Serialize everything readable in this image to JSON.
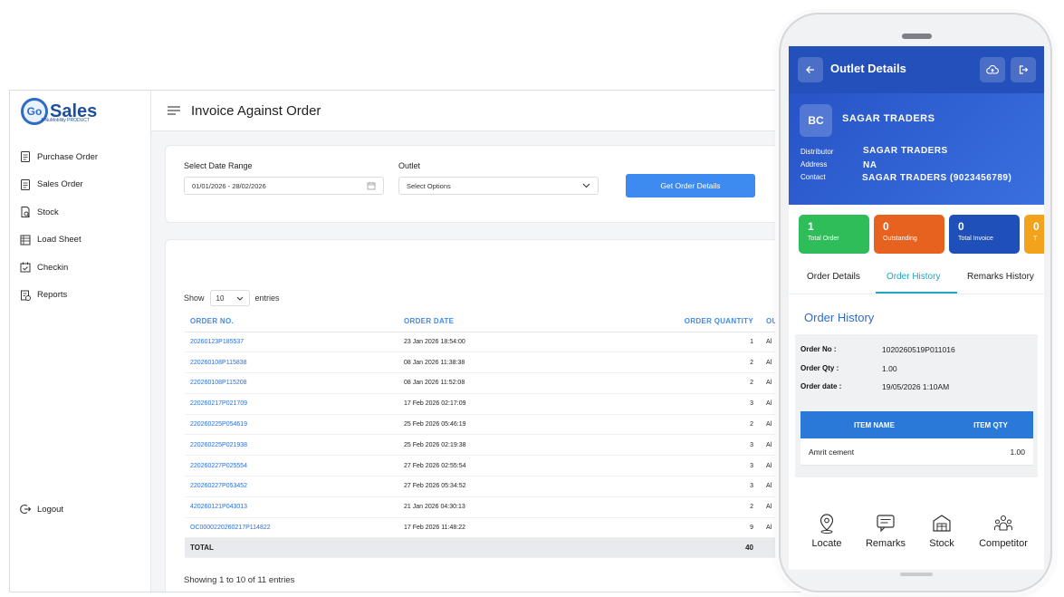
{
  "app": {
    "logo_text": "Sales",
    "logo_mark": "Go",
    "logo_sub": "A NuMobility PRODUCT",
    "page_title": "Invoice Against Order",
    "sidebar": {
      "items": [
        {
          "label": "Purchase Order",
          "icon": "document-icon"
        },
        {
          "label": "Sales Order",
          "icon": "document-icon"
        },
        {
          "label": "Stock",
          "icon": "search-document-icon"
        },
        {
          "label": "Load Sheet",
          "icon": "sheet-icon"
        },
        {
          "label": "Checkin",
          "icon": "calendar-check-icon"
        },
        {
          "label": "Reports",
          "icon": "report-icon"
        }
      ],
      "logout_label": "Logout"
    },
    "filters": {
      "date_label": "Select Date Range",
      "date_value": "01/01/2026 - 28/02/2026",
      "outlet_label": "Outlet",
      "outlet_value": "Select Options",
      "button_label": "Get Order Details"
    },
    "table": {
      "show_label": "Show",
      "entries_label": "entries",
      "page_size": "10",
      "columns": [
        "ORDER NO.",
        "ORDER DATE",
        "ORDER QUANTITY",
        "OU"
      ],
      "rows": [
        {
          "order_no": "20260123P185537",
          "date": "23 Jan 2026 18:54:00",
          "qty": "1",
          "ou": "Al"
        },
        {
          "order_no": "220260108P115838",
          "date": "08 Jan 2026 11:38:38",
          "qty": "2",
          "ou": "Al"
        },
        {
          "order_no": "220260108P115208",
          "date": "08 Jan 2026 11:52:08",
          "qty": "2",
          "ou": "Al"
        },
        {
          "order_no": "220260217P021709",
          "date": "17 Feb 2026 02:17:09",
          "qty": "3",
          "ou": "Al"
        },
        {
          "order_no": "220260225P054619",
          "date": "25 Feb 2026 05:46:19",
          "qty": "2",
          "ou": "Al"
        },
        {
          "order_no": "220260225P021938",
          "date": "25 Feb 2026 02:19:38",
          "qty": "3",
          "ou": "Al"
        },
        {
          "order_no": "220260227P025554",
          "date": "27 Feb 2026 02:55:54",
          "qty": "3",
          "ou": "Al"
        },
        {
          "order_no": "220260227P053452",
          "date": "27 Feb 2026 05:34:52",
          "qty": "3",
          "ou": "Al"
        },
        {
          "order_no": "420260121P043013",
          "date": "21 Jan 2026 04:30:13",
          "qty": "2",
          "ou": "Al"
        },
        {
          "order_no": "OC0000220260217P114822",
          "date": "17 Feb 2026 11:48:22",
          "qty": "9",
          "ou": "Al"
        }
      ],
      "total_label": "TOTAL",
      "total_qty": "40",
      "info": "Showing 1 to 10 of 11 entries"
    }
  },
  "phone": {
    "title": "Outlet Details",
    "avatar": "BC",
    "outlet_name": "SAGAR TRADERS",
    "distributor_label": "Distributor",
    "distributor_value": "SAGAR TRADERS",
    "address_label": "Address",
    "address_value": "NA",
    "contact_label": "Contact",
    "contact_value": "SAGAR TRADERS (9023456789)",
    "stats": [
      {
        "value": "1",
        "label": "Total Order",
        "color": "#2ebd59"
      },
      {
        "value": "0",
        "label": "Outstanding",
        "color": "#e8621f"
      },
      {
        "value": "0",
        "label": "Total Invoice",
        "color": "#1f4fb8"
      },
      {
        "value": "0",
        "label": "T",
        "color": "#f3a21c"
      }
    ],
    "tabs": [
      "Order Details",
      "Order History",
      "Remarks History"
    ],
    "history": {
      "title": "Order History",
      "order_no_label": "Order No :",
      "order_no_value": "1020260519P011016",
      "order_qty_label": "Order Qty :",
      "order_qty_value": "1.00",
      "order_date_label": "Order date :",
      "order_date_value": "19/05/2026 1:10AM",
      "item_name_header": "ITEM NAME",
      "item_qty_header": "ITEM QTY",
      "item_name": "Amrit cement",
      "item_qty": "1.00"
    },
    "bottom_nav": [
      "Locate",
      "Remarks",
      "Stock",
      "Competitor"
    ]
  }
}
